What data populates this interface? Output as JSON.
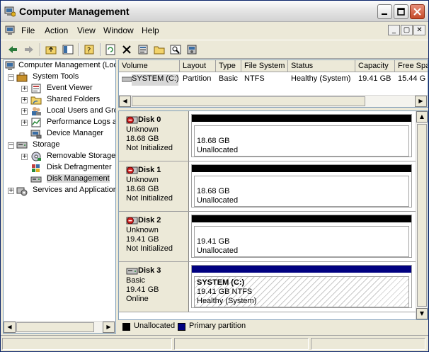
{
  "window": {
    "title": "Computer Management"
  },
  "menubar": {
    "items": [
      "File",
      "Action",
      "View",
      "Window",
      "Help"
    ]
  },
  "mdi_buttons": {
    "minimize": "_",
    "restore": "▢",
    "close": "✕"
  },
  "tree": {
    "items": [
      {
        "label": "Computer Management (Loc"
      },
      {
        "label": "System Tools"
      },
      {
        "label": "Event Viewer"
      },
      {
        "label": "Shared Folders"
      },
      {
        "label": "Local Users and Gro"
      },
      {
        "label": "Performance Logs a"
      },
      {
        "label": "Device Manager"
      },
      {
        "label": "Storage"
      },
      {
        "label": "Removable Storage"
      },
      {
        "label": "Disk Defragmenter"
      },
      {
        "label": "Disk Management"
      },
      {
        "label": "Services and Applicatior"
      }
    ]
  },
  "volume_list": {
    "columns": [
      "Volume",
      "Layout",
      "Type",
      "File System",
      "Status",
      "Capacity",
      "Free Spa"
    ],
    "rows": [
      {
        "volume": "SYSTEM (C:)",
        "layout": "Partition",
        "type": "Basic",
        "fs": "NTFS",
        "status": "Healthy (System)",
        "capacity": "19.41 GB",
        "free": "15.44 G"
      }
    ]
  },
  "disks": [
    {
      "name": "Disk 0",
      "type": "Unknown",
      "size": "18.68 GB",
      "state": "Not Initialized",
      "vol_line1": "18.68 GB",
      "vol_line2": "Unallocated",
      "vol_line3": "",
      "bar_color": "#000000"
    },
    {
      "name": "Disk 1",
      "type": "Unknown",
      "size": "18.68 GB",
      "state": "Not Initialized",
      "vol_line1": "18.68 GB",
      "vol_line2": "Unallocated",
      "vol_line3": "",
      "bar_color": "#000000"
    },
    {
      "name": "Disk 2",
      "type": "Unknown",
      "size": "19.41 GB",
      "state": "Not Initialized",
      "vol_line1": "19.41 GB",
      "vol_line2": "Unallocated",
      "vol_line3": "",
      "bar_color": "#000000"
    },
    {
      "name": "Disk 3",
      "type": "Basic",
      "size": "19.41 GB",
      "state": "Online",
      "vol_title": "SYSTEM  (C:)",
      "vol_line1": "19.41 GB NTFS",
      "vol_line2": "Healthy (System)",
      "bar_color": "#000080"
    }
  ],
  "legend": {
    "unallocated": "Unallocated",
    "primary": "Primary partition",
    "unallocated_color": "#000000",
    "primary_color": "#000080"
  }
}
